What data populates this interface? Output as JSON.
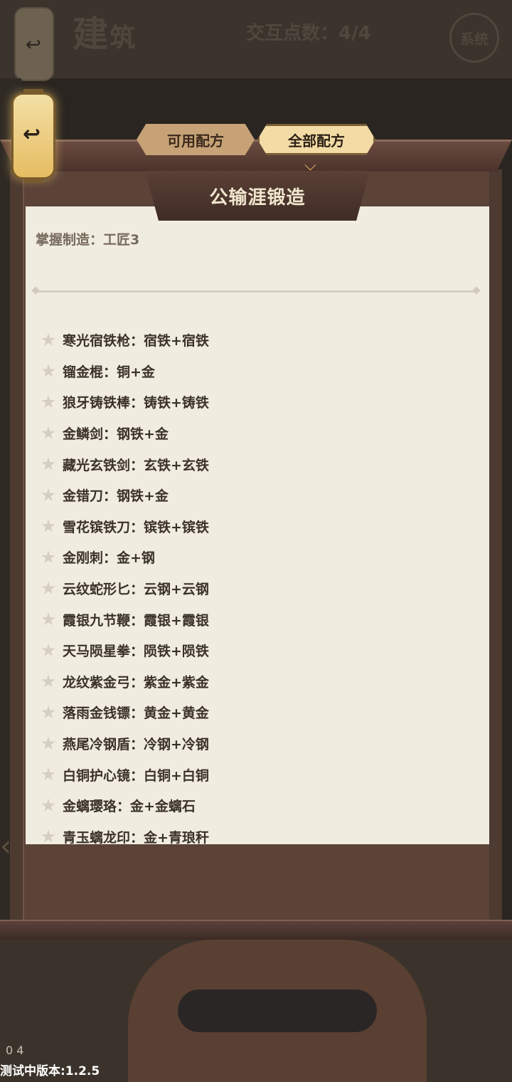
{
  "header": {
    "title_main": "建",
    "title_sub": "筑",
    "interaction_points": "交互点数：4/4",
    "system_button": "系统",
    "back_glyph": "↩"
  },
  "tabs": [
    {
      "label": "可用配方",
      "active": false
    },
    {
      "label": "全部配方",
      "active": true
    }
  ],
  "panel": {
    "title": "公输涯锻造",
    "mastery": "掌握制造：工匠3"
  },
  "recipes": [
    "寒光宿铁枪：宿铁+宿铁",
    "镏金棍：铜+金",
    "狼牙铸铁棒：铸铁+铸铁",
    "金鳞剑：钢铁+金",
    "藏光玄铁剑：玄铁+玄铁",
    "金错刀：钢铁+金",
    "雪花镔铁刀：镔铁+镔铁",
    "金刚刺：金+钢",
    "云纹蛇形匕：云钢+云钢",
    "霞银九节鞭：霞银+霞银",
    "天马陨星拳：陨铁+陨铁",
    "龙纹紫金弓：紫金+紫金",
    "落雨金钱镖：黄金+黄金",
    "燕尾冷钢盾：冷钢+冷钢",
    "白铜护心镜：白铜+白铜",
    "金螭璎珞：金+金螭石",
    "青玉螭龙印：金+青琅秆"
  ],
  "background": {
    "stat_text": "0  4"
  },
  "footer": {
    "version": "测试中版本:1.2.5"
  },
  "colors": {
    "parchment": "#f1ece0",
    "frame": "#5b4338",
    "tab_active": "#f3dba5",
    "tab_inactive": "#c7a277",
    "lantern": "#e6bd62"
  }
}
